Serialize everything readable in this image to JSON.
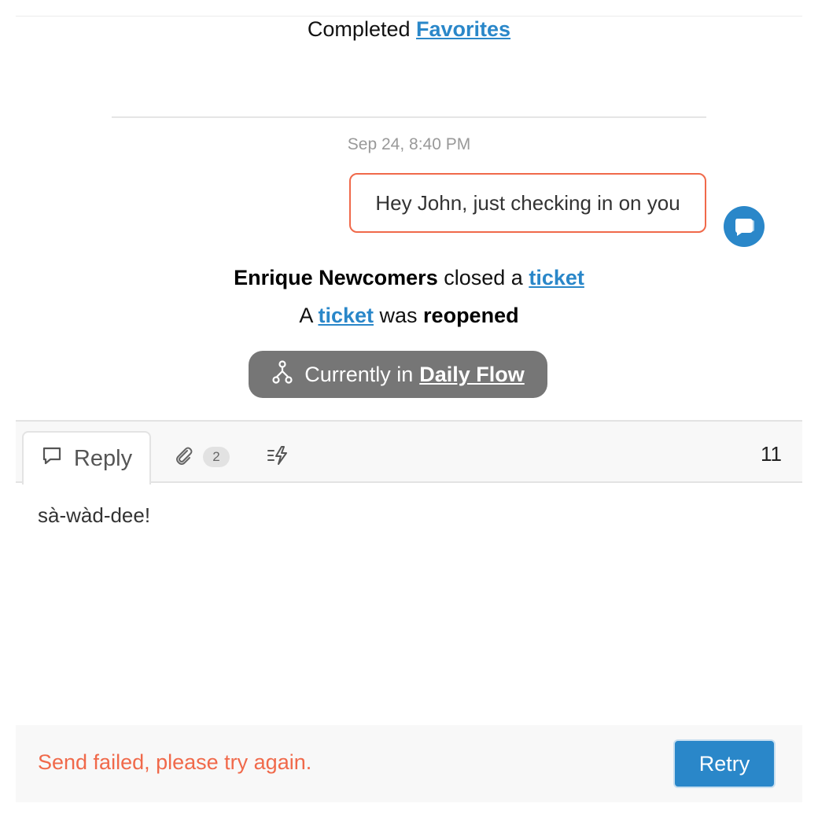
{
  "activity": {
    "completed": {
      "prefix": "Completed",
      "link": "Favorites"
    },
    "timestamp": "Sep 24, 8:40 PM",
    "message": "Hey John, just checking in on you",
    "closed": {
      "actor": "Enrique Newcomers",
      "verb": "closed a",
      "link": "ticket"
    },
    "reopened": {
      "prefix": "A",
      "link": "ticket",
      "verb": "was",
      "status": "reopened"
    },
    "flow": {
      "prefix": "Currently in",
      "link": "Daily Flow"
    }
  },
  "composer": {
    "tabs": {
      "reply_label": "Reply",
      "attachments_count": "2"
    },
    "char_count": "11",
    "text": "sà-wàd-dee!"
  },
  "footer": {
    "error": "Send failed, please try again.",
    "retry_label": "Retry"
  },
  "colors": {
    "accent": "#2a87c9",
    "error": "#f0694a",
    "pill": "#767676"
  },
  "icons": [
    "chat-bubble-icon",
    "flow-branch-icon",
    "reply-speech-icon",
    "paperclip-icon",
    "lightning-macro-icon"
  ]
}
